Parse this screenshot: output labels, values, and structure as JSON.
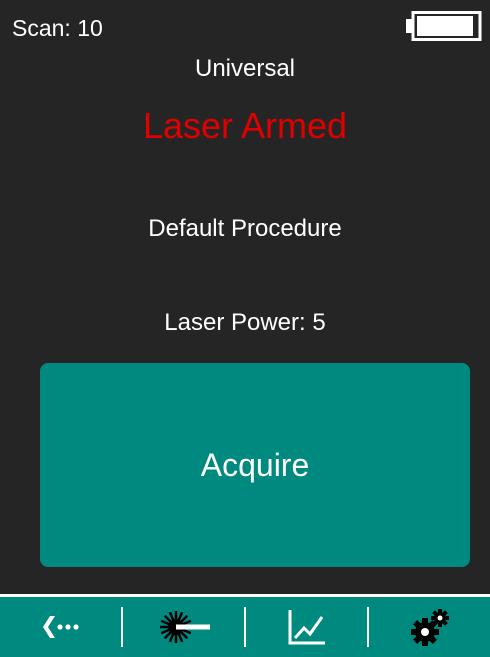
{
  "status": {
    "scan_label": "Scan: 10",
    "battery_icon": "battery-icon",
    "battery_level": 0.95
  },
  "main": {
    "mode": "Universal",
    "laser_status": "Laser Armed",
    "procedure": "Default Procedure",
    "laser_power": "Laser Power: 5"
  },
  "actions": {
    "acquire_label": "Acquire"
  },
  "nav": [
    {
      "icon": "back-icon"
    },
    {
      "icon": "laser-icon"
    },
    {
      "icon": "chart-icon"
    },
    {
      "icon": "settings-icon"
    }
  ],
  "colors": {
    "background": "#252525",
    "accent": "#00897f",
    "laser_status": "#e00000",
    "text": "#ffffff"
  }
}
